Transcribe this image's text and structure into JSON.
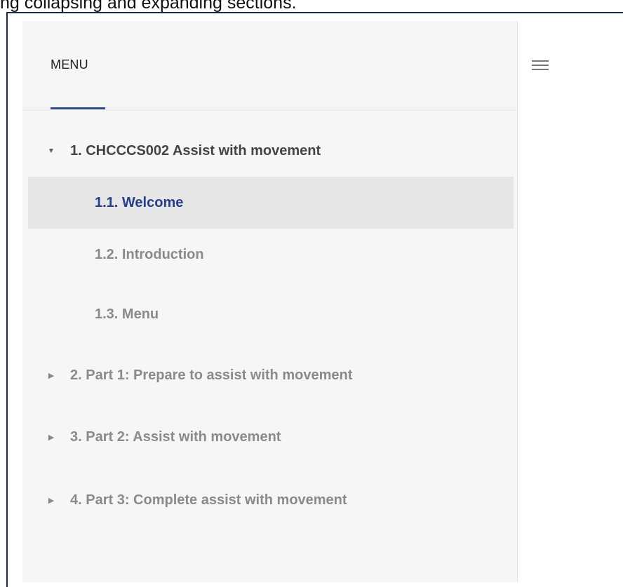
{
  "caption": "ng collapsing and expanding sections.",
  "sidebar": {
    "title": "MENU",
    "items": [
      {
        "label": "1. CHCCCS002 Assist with movement",
        "expanded": true,
        "arrow_icon": "caret-down-icon"
      },
      {
        "label": "1.1. Welcome",
        "active": true
      },
      {
        "label": "1.2. Introduction"
      },
      {
        "label": "1.3. Menu"
      },
      {
        "label": "2. Part 1: Prepare to assist with movement",
        "expanded": false,
        "arrow_icon": "caret-right-icon"
      },
      {
        "label": "3. Part 2: Assist with movement",
        "expanded": false,
        "arrow_icon": "caret-right-icon"
      },
      {
        "label": "4. Part 3: Complete assist with movement",
        "expanded": false,
        "arrow_icon": "caret-right-icon"
      }
    ]
  },
  "content": {
    "menu_toggle_icon": "hamburger-icon"
  },
  "colors": {
    "accent": "#263e87",
    "sidebar_bg": "#f6f6f6",
    "active_bg": "#e6e6e6",
    "frame_border": "#1c2a44"
  }
}
